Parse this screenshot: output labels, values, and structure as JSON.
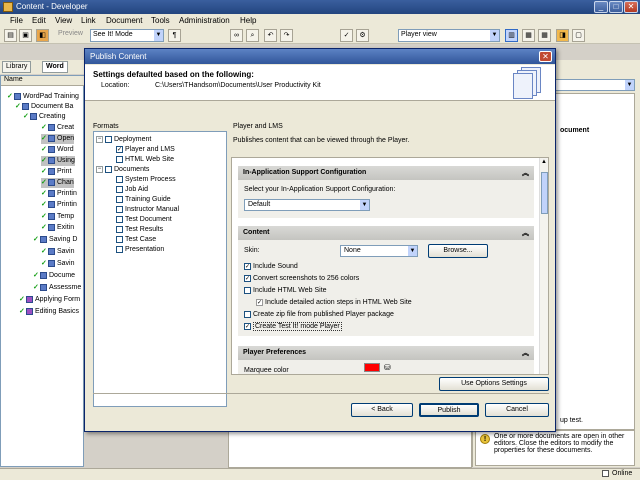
{
  "window": {
    "title": "Content - Developer"
  },
  "menu": [
    "File",
    "Edit",
    "View",
    "Link",
    "Document",
    "Tools",
    "Administration",
    "Help"
  ],
  "toolbar": {
    "preview_label": "Preview",
    "mode_select": "See It! Mode",
    "view_select": "Player view"
  },
  "library": {
    "tabs": [
      "Library",
      "Word"
    ],
    "column": "Name",
    "tree": [
      "WordPad Training",
      "Document Ba",
      "Creating",
      "Creat",
      "Open",
      "Word",
      "Using",
      "Print",
      "Chan",
      "Printin",
      "Printin",
      "Temp",
      "Exitin",
      "Saving D",
      "Savin",
      "Savin",
      "Docume",
      "Assessme",
      "Applying Form",
      "Editing Basics"
    ]
  },
  "right_pane": {
    "heading": "ocument",
    "note1": "up test.",
    "notice": "One or more documents are open in other editors. Close the editors to modify the properties for these documents."
  },
  "status": {
    "online": "Online"
  },
  "dialog": {
    "title": "Publish Content",
    "header": "Settings defaulted based on the following:",
    "location_label": "Location:",
    "location_value": "C:\\Users\\THandsom\\Documents\\User Productivity Kit",
    "formats_label": "Formats",
    "formats": {
      "deployment": "Deployment",
      "deployment_items": [
        "Player and LMS",
        "HTML Web Site"
      ],
      "documents": "Documents",
      "document_items": [
        "System Process",
        "Job Aid",
        "Training Guide",
        "Instructor Manual",
        "Test Document",
        "Test Results",
        "Test Case",
        "Presentation"
      ]
    },
    "panel_title": "Player and LMS",
    "panel_desc": "Publishes content that can be viewed through the Player.",
    "sections": {
      "support": {
        "title": "In-Application Support Configuration",
        "select_label": "Select your In-Application Support Configuration:",
        "select_value": "Default"
      },
      "content": {
        "title": "Content",
        "skin_label": "Skin:",
        "skin_value": "None",
        "browse": "Browse...",
        "options": [
          "Include Sound",
          "Convert screenshots to 256 colors",
          "Include HTML Web Site",
          "Include detailed action steps in HTML Web Site",
          "Create zip file from published Player package",
          "Create Test It! mode Player"
        ],
        "checked": [
          true,
          true,
          false,
          true,
          false,
          true
        ]
      },
      "player_prefs": {
        "title": "Player Preferences",
        "marquee_label": "Marquee color",
        "marquee_color": "#ff0000"
      }
    },
    "use_options": "Use Options Settings",
    "back": "< Back",
    "publish": "Publish",
    "cancel": "Cancel"
  }
}
